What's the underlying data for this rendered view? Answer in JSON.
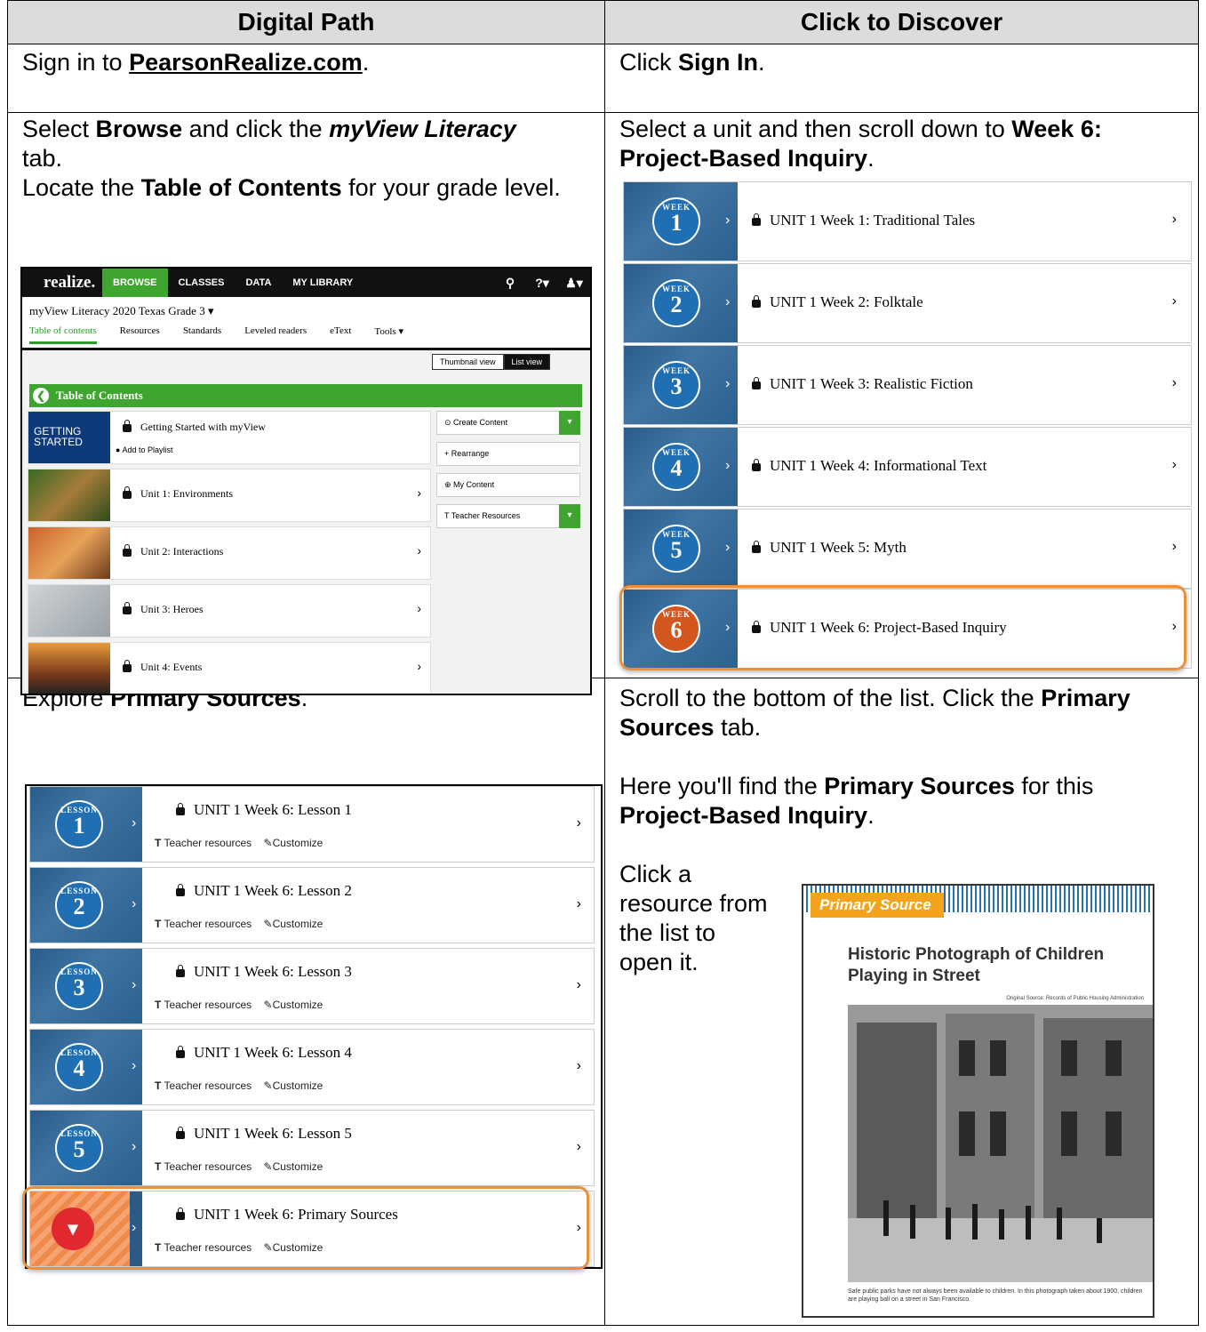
{
  "table": {
    "headers": [
      "Digital Path",
      "Click to Discover"
    ],
    "row1": {
      "left": {
        "pre": "Sign in to ",
        "link": "PearsonRealize.com",
        "post": "."
      },
      "right": {
        "pre": "Click ",
        "bold": "Sign In",
        "post": "."
      }
    },
    "row2": {
      "left": {
        "p1": "Select ",
        "b1": "Browse",
        "p2": " and click the ",
        "b2": "myView Literacy",
        "p3": " tab.",
        "p4": "Locate the ",
        "b3": "Table of Contents",
        "p5": " for your grade level."
      },
      "right": {
        "p1": "Select a unit and then scroll down to ",
        "b1": "Week 6: Project-Based Inquiry",
        "p2": "."
      }
    },
    "row3": {
      "left": {
        "p1": "Explore ",
        "b1": "Primary Sources",
        "p2": "."
      },
      "right": {
        "p1": "Scroll to the bottom of the list. Click the ",
        "b1": "Primary Sources",
        "p2": " tab.",
        "p3": "Here you'll find the ",
        "b2": "Primary Sources",
        "p4": " for this ",
        "b3": "Project-Based Inquiry",
        "p5": ".",
        "p6": "Click a resource from the list to open it."
      }
    }
  },
  "realize": {
    "logo": "realize.",
    "nav": [
      "BROWSE",
      "CLASSES",
      "DATA",
      "MY LIBRARY"
    ],
    "program": "myView Literacy 2020 Texas Grade 3 ▾",
    "tabs": [
      "Table of contents",
      "Resources",
      "Standards",
      "Leveled readers",
      "eText",
      "Tools ▾"
    ],
    "view_toggle": [
      "Thumbnail view",
      "List view"
    ],
    "toc_title": "Table of Contents",
    "getting_started": "Getting Started with myView",
    "gs_img": "GETTING STARTED",
    "add_playlist": "Add to Playlist",
    "units": [
      "Unit 1: Environments",
      "Unit 2: Interactions",
      "Unit 3: Heroes",
      "Unit 4: Events"
    ],
    "side": [
      "Create Content",
      "Rearrange",
      "My Content",
      "Teacher Resources"
    ]
  },
  "weeks": {
    "tag": "WEEK",
    "items": [
      {
        "n": "1",
        "label": "UNIT 1 Week 1: Traditional Tales"
      },
      {
        "n": "2",
        "label": "UNIT 1 Week 2: Folktale"
      },
      {
        "n": "3",
        "label": "UNIT 1 Week 3: Realistic Fiction"
      },
      {
        "n": "4",
        "label": "UNIT 1 Week 4: Informational Text"
      },
      {
        "n": "5",
        "label": "UNIT 1 Week 5: Myth"
      },
      {
        "n": "6",
        "label": "UNIT 1 Week 6: Project-Based Inquiry"
      }
    ]
  },
  "lessons": {
    "tag": "LESSON",
    "teacher": "Teacher resources",
    "customize": "Customize",
    "items": [
      {
        "n": "1",
        "label": "UNIT 1 Week 6: Lesson 1"
      },
      {
        "n": "2",
        "label": "UNIT 1 Week 6: Lesson 2"
      },
      {
        "n": "3",
        "label": "UNIT 1 Week 6: Lesson 3"
      },
      {
        "n": "4",
        "label": "UNIT 1 Week 6: Lesson 4"
      },
      {
        "n": "5",
        "label": "UNIT 1 Week 6: Lesson 5"
      },
      {
        "n": "",
        "label": "UNIT 1 Week 6: Primary Sources"
      }
    ]
  },
  "primary_source": {
    "tag": "Primary Source",
    "title": "Historic Photograph of Children Playing in Street",
    "source": "Original Source: Records of Public Housing Administration",
    "caption": "Safe public parks have not always been available to children. In this photograph taken about 1900, children are playing ball on a street in San Francisco."
  }
}
